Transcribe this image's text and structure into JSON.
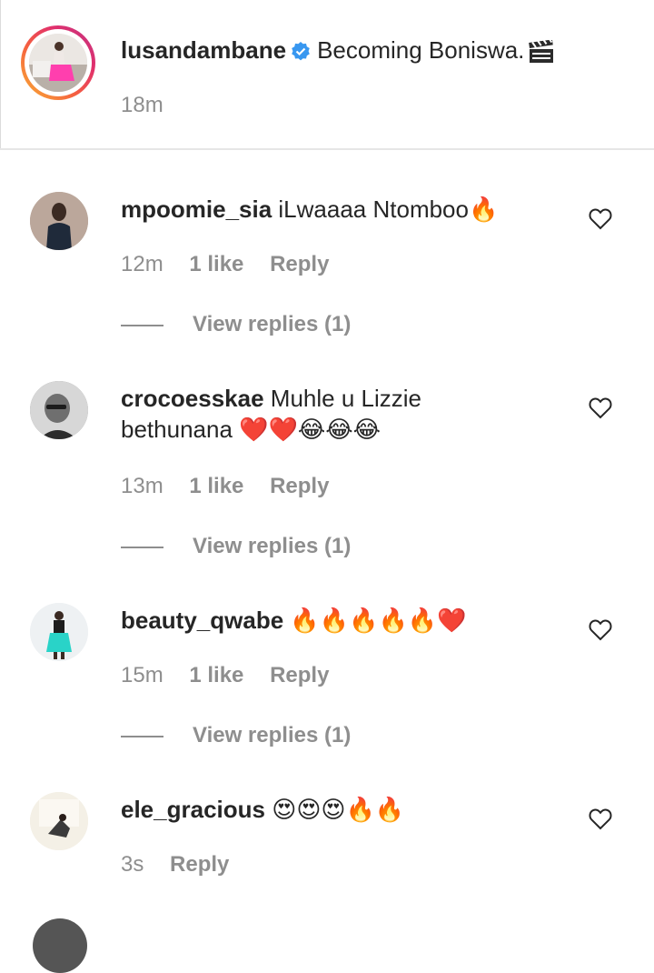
{
  "post": {
    "username": "lusandambane",
    "caption": "Becoming Boniswa.",
    "caption_emoji": "🎬",
    "time": "18m"
  },
  "comments": [
    {
      "username": "mpoomie_sia",
      "text": "iLwaaaa Ntomboo🔥",
      "time": "12m",
      "likes": "1 like",
      "reply": "Reply",
      "view_replies": "View replies (1)"
    },
    {
      "username": "crocoesskae",
      "text": "Muhle u Lizzie bethunana ❤️❤️😂😂😂",
      "time": "13m",
      "likes": "1 like",
      "reply": "Reply",
      "view_replies": "View replies (1)"
    },
    {
      "username": "beauty_qwabe",
      "text": "🔥🔥🔥🔥🔥❤️",
      "time": "15m",
      "likes": "1 like",
      "reply": "Reply",
      "view_replies": "View replies (1)"
    },
    {
      "username": "ele_gracious",
      "text": "😍😍😍🔥🔥",
      "time": "3s",
      "reply": "Reply"
    }
  ],
  "colors": {
    "verified": "#3897f0",
    "muted": "#8e8e8e",
    "text": "#262626"
  },
  "icons": {
    "like": "heart-outline-icon",
    "verified": "verified-badge-icon"
  }
}
